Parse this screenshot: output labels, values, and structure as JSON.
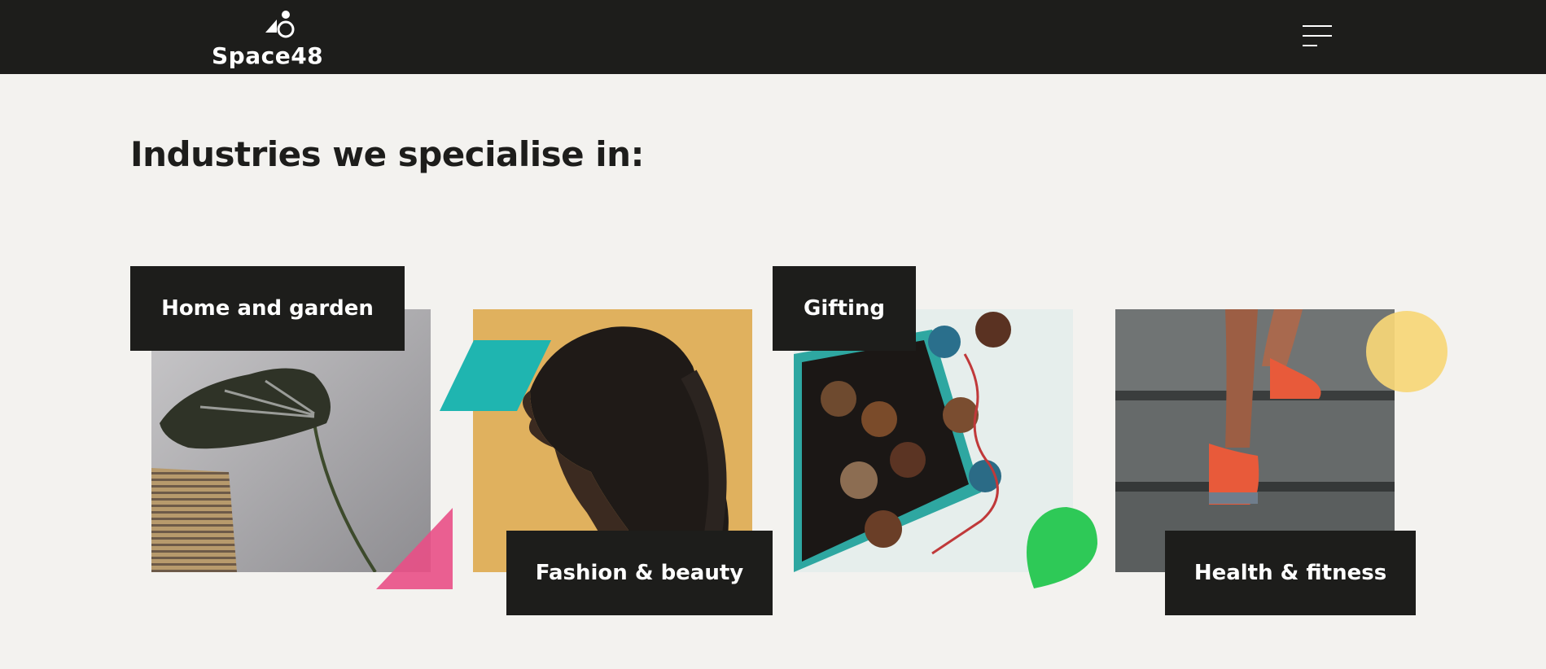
{
  "header": {
    "logo_text": "Space48",
    "logo_icon": "triangle-circle-logo-icon",
    "menu_icon": "hamburger-menu-icon"
  },
  "main": {
    "heading": "Industries we specialise in:",
    "industries": [
      {
        "label": "Home and garden",
        "image": "monstera-leaf-photo",
        "accent": "pink-triangle",
        "accent_color": "#e94f86"
      },
      {
        "label": "Fashion & beauty",
        "image": "woman-profile-braid-photo",
        "accent": "teal-parallelogram",
        "accent_color": "#1fb5b0"
      },
      {
        "label": "Gifting",
        "image": "chocolate-box-photo",
        "accent": "green-leaf",
        "accent_color": "#2ec957"
      },
      {
        "label": "Health & fitness",
        "image": "running-stairs-photo",
        "accent": "yellow-circle",
        "accent_color": "#f7d777"
      }
    ]
  },
  "colors": {
    "header_bg": "#1d1d1b",
    "page_bg": "#f3f2ef",
    "label_bg": "#1d1d1b",
    "label_text": "#ffffff"
  }
}
